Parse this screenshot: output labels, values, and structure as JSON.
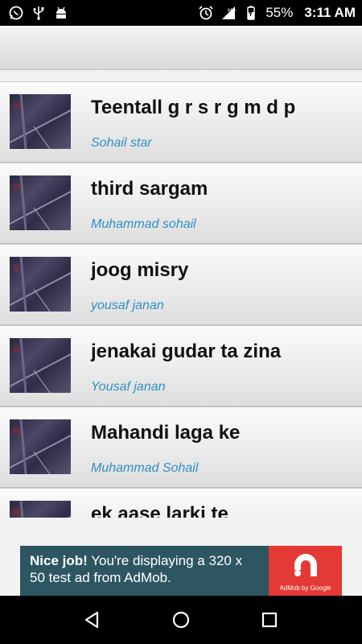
{
  "status_bar": {
    "battery": "55%",
    "time": "3:11 AM",
    "icons": [
      "whatsapp-icon",
      "usb-icon",
      "android-debug-icon",
      "alarm-icon",
      "signal-icon",
      "data-h-plus-icon",
      "battery-charging-icon"
    ]
  },
  "songs": [
    {
      "title": "Teentall g r s r g m d p",
      "artist": "Sohail star"
    },
    {
      "title": "third sargam",
      "artist": "Muhammad sohail"
    },
    {
      "title": "joog misry",
      "artist": "yousaf janan"
    },
    {
      "title": "jenakai gudar ta zina",
      "artist": "Yousaf janan"
    },
    {
      "title": "Mahandi laga ke",
      "artist": "Muhammad Sohail"
    },
    {
      "title": "ek aase larki te",
      "artist": ""
    }
  ],
  "ad": {
    "nice": "Nice job!",
    "line": " You're displaying a 320 x 50 test ad from AdMob.",
    "brand": "AdMob by Google"
  },
  "colors": {
    "artist_text": "#2e8fc4",
    "ad_background": "#2e5662",
    "ad_logo": "#e53935"
  }
}
